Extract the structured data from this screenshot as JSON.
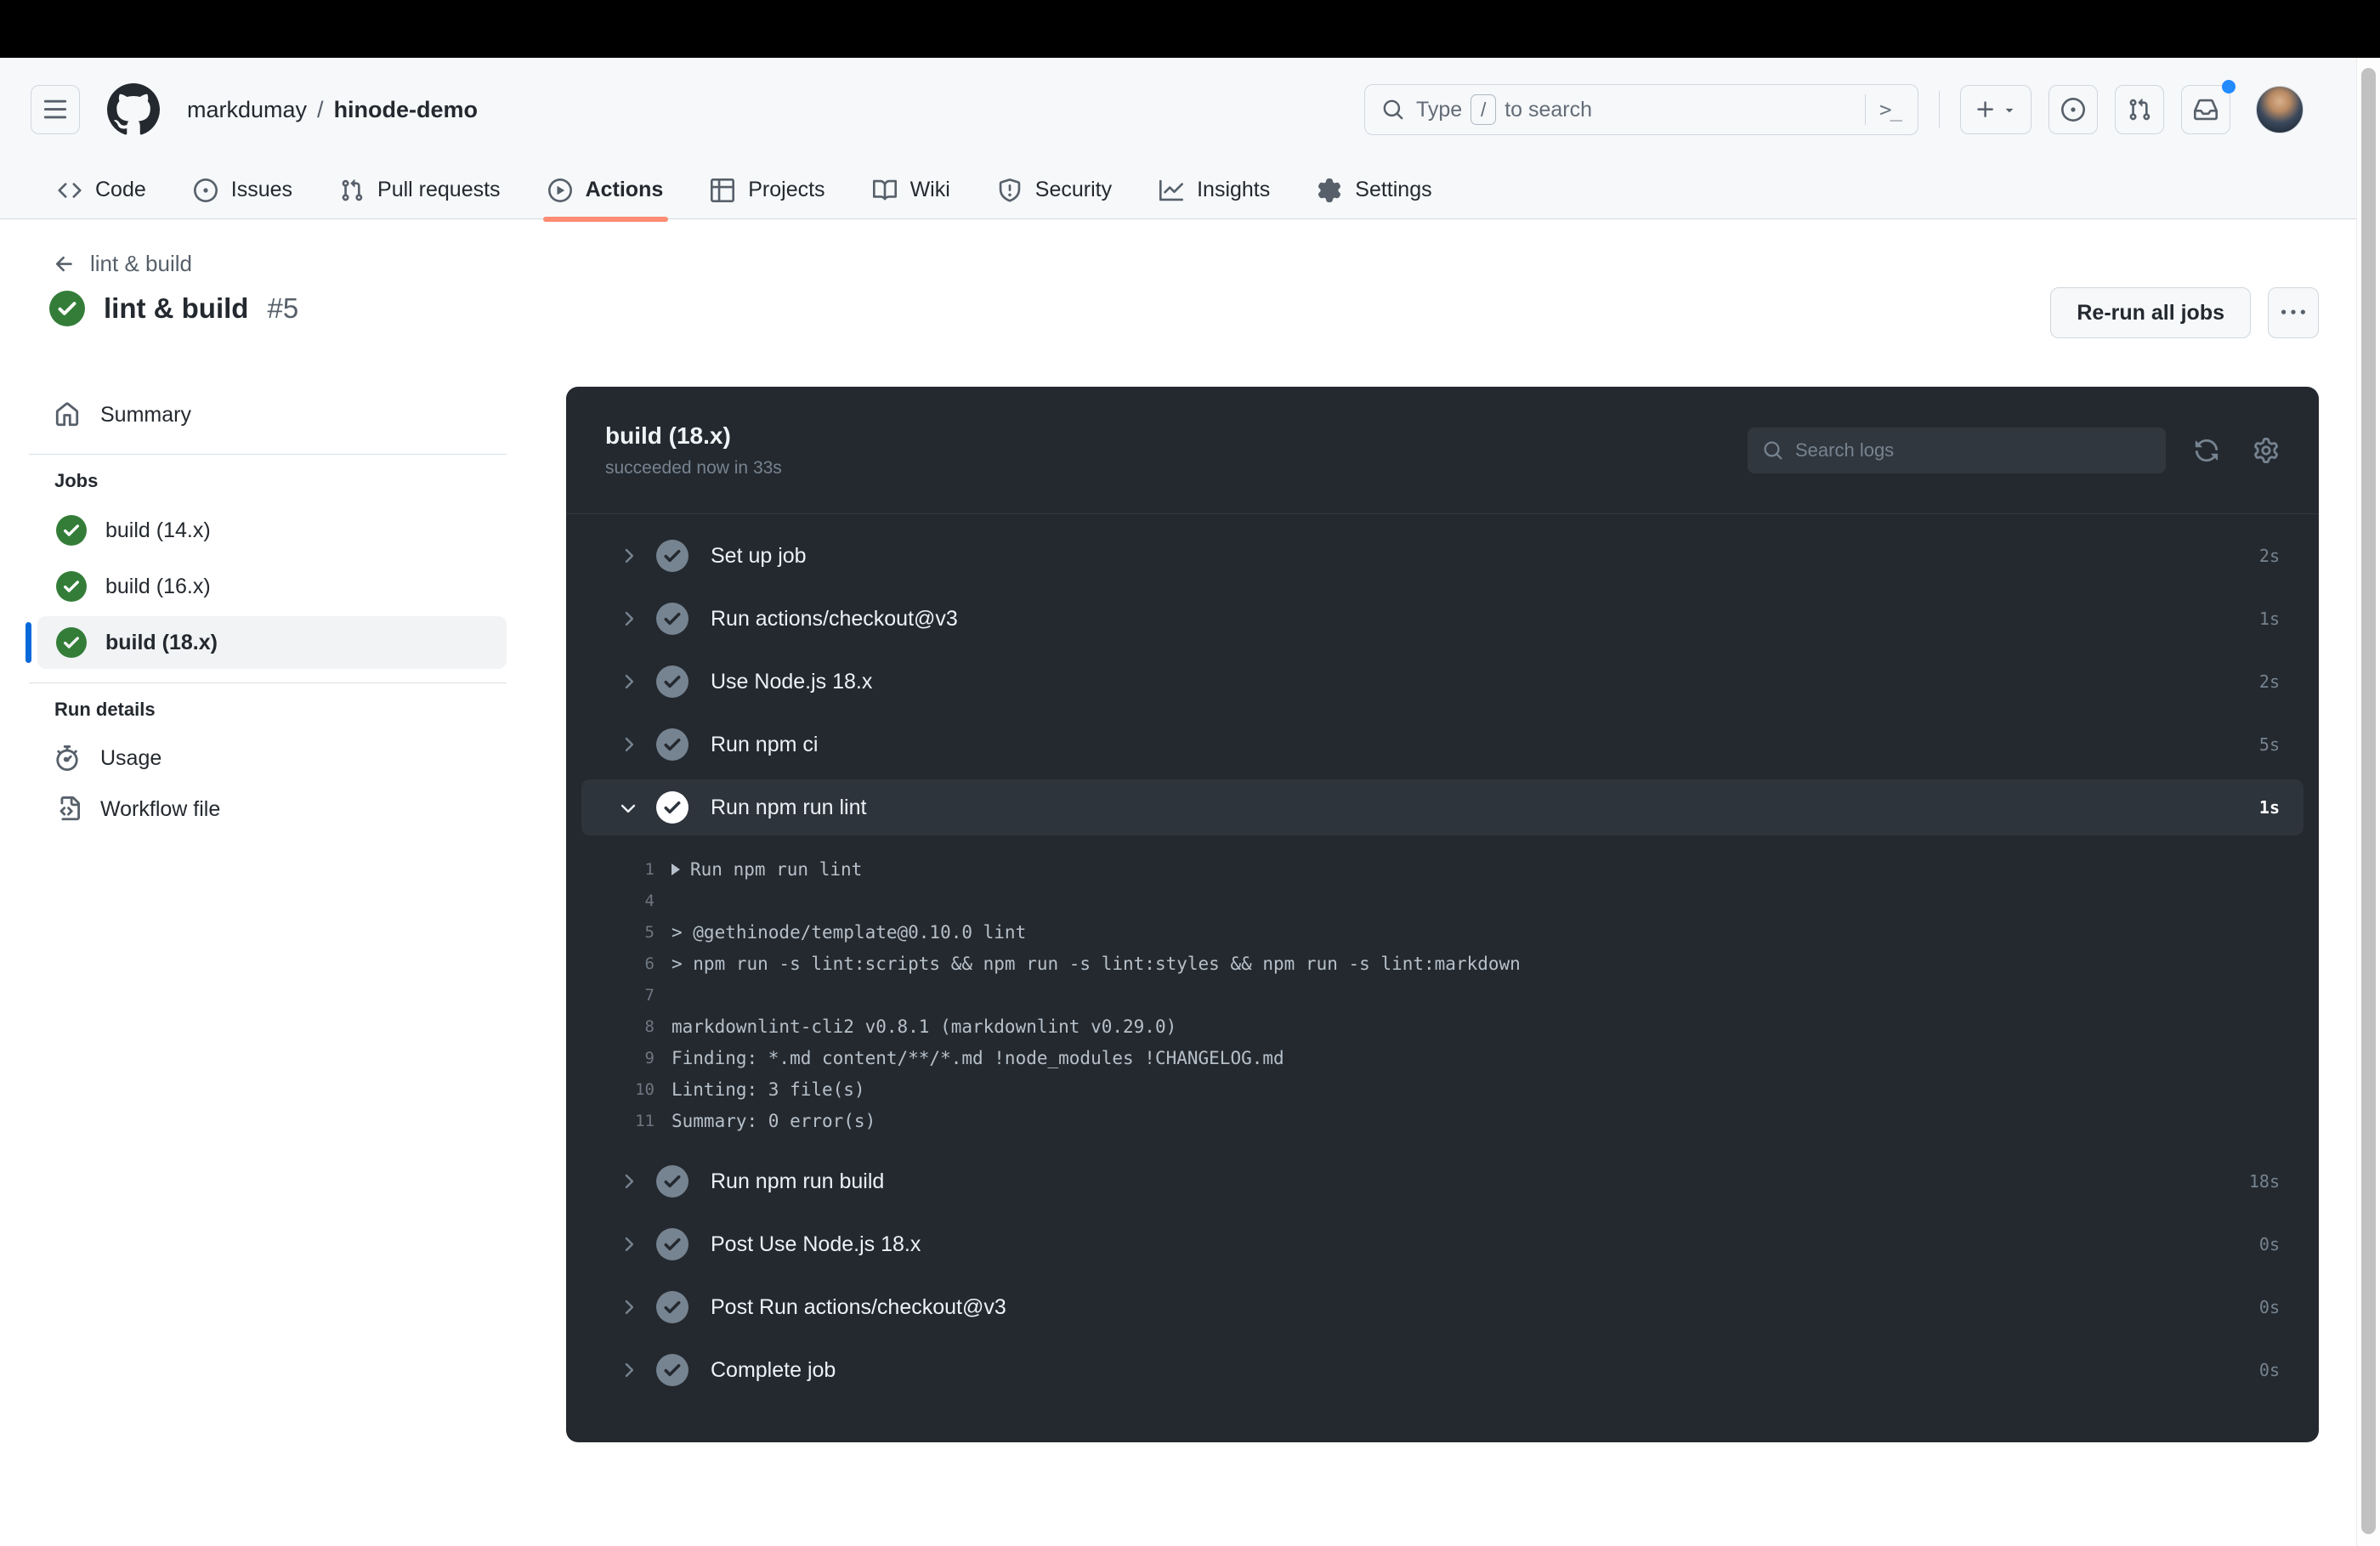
{
  "topnav": {
    "breadcrumb": {
      "owner": "markdumay",
      "separator": "/",
      "repo": "hinode-demo"
    },
    "search": {
      "placeholder_prefix": "Type",
      "slash_key": "/",
      "placeholder_suffix": "to search",
      "command_palette_glyph": ">_"
    },
    "tabs": [
      {
        "label": "Code",
        "icon": "code-icon",
        "active": false
      },
      {
        "label": "Issues",
        "icon": "issue-opened-icon",
        "active": false
      },
      {
        "label": "Pull requests",
        "icon": "git-pull-request-icon",
        "active": false
      },
      {
        "label": "Actions",
        "icon": "play-icon",
        "active": true
      },
      {
        "label": "Projects",
        "icon": "table-icon",
        "active": false
      },
      {
        "label": "Wiki",
        "icon": "book-icon",
        "active": false
      },
      {
        "label": "Security",
        "icon": "shield-icon",
        "active": false
      },
      {
        "label": "Insights",
        "icon": "graph-icon",
        "active": false
      },
      {
        "label": "Settings",
        "icon": "gear-icon",
        "active": false
      }
    ]
  },
  "run_header": {
    "back_label": "lint & build",
    "title": "lint & build",
    "run_number": "#5",
    "rerun_button_label": "Re-run all jobs"
  },
  "sidebar": {
    "summary_label": "Summary",
    "jobs_heading": "Jobs",
    "jobs": [
      {
        "label": "build (14.x)",
        "selected": false
      },
      {
        "label": "build (16.x)",
        "selected": false
      },
      {
        "label": "build (18.x)",
        "selected": true
      }
    ],
    "run_details_heading": "Run details",
    "run_details": [
      {
        "label": "Usage",
        "icon": "stopwatch-icon"
      },
      {
        "label": "Workflow file",
        "icon": "file-code-icon"
      }
    ]
  },
  "job_panel": {
    "title": "build (18.x)",
    "status_line": "succeeded now in 33s",
    "search_placeholder": "Search logs",
    "steps": [
      {
        "label": "Set up job",
        "duration": "2s",
        "expanded": false
      },
      {
        "label": "Run actions/checkout@v3",
        "duration": "1s",
        "expanded": false
      },
      {
        "label": "Use Node.js 18.x",
        "duration": "2s",
        "expanded": false
      },
      {
        "label": "Run npm ci",
        "duration": "5s",
        "expanded": false
      },
      {
        "label": "Run npm run lint",
        "duration": "1s",
        "expanded": true,
        "log_lines": [
          {
            "num": "1",
            "text": "Run npm run lint",
            "group": true
          },
          {
            "num": "4",
            "text": "",
            "group": false
          },
          {
            "num": "5",
            "text": "> @gethinode/template@0.10.0 lint",
            "group": false
          },
          {
            "num": "6",
            "text": "> npm run -s lint:scripts && npm run -s lint:styles && npm run -s lint:markdown",
            "group": false
          },
          {
            "num": "7",
            "text": "",
            "group": false
          },
          {
            "num": "8",
            "text": "markdownlint-cli2 v0.8.1 (markdownlint v0.29.0)",
            "group": false
          },
          {
            "num": "9",
            "text": "Finding: *.md content/**/*.md !node_modules !CHANGELOG.md",
            "group": false
          },
          {
            "num": "10",
            "text": "Linting: 3 file(s)",
            "group": false
          },
          {
            "num": "11",
            "text": "Summary: 0 error(s)",
            "group": false
          }
        ]
      },
      {
        "label": "Run npm run build",
        "duration": "18s",
        "expanded": false
      },
      {
        "label": "Post Use Node.js 18.x",
        "duration": "0s",
        "expanded": false
      },
      {
        "label": "Post Run actions/checkout@v3",
        "duration": "0s",
        "expanded": false
      },
      {
        "label": "Complete job",
        "duration": "0s",
        "expanded": false
      }
    ]
  },
  "colors": {
    "accent_underline": "#fd8c73",
    "success_green": "#347d39",
    "selected_bar_blue": "#0969da",
    "notification_blue": "#218bff",
    "panel_bg": "#24292f",
    "panel_row_highlight": "#2e343c"
  }
}
